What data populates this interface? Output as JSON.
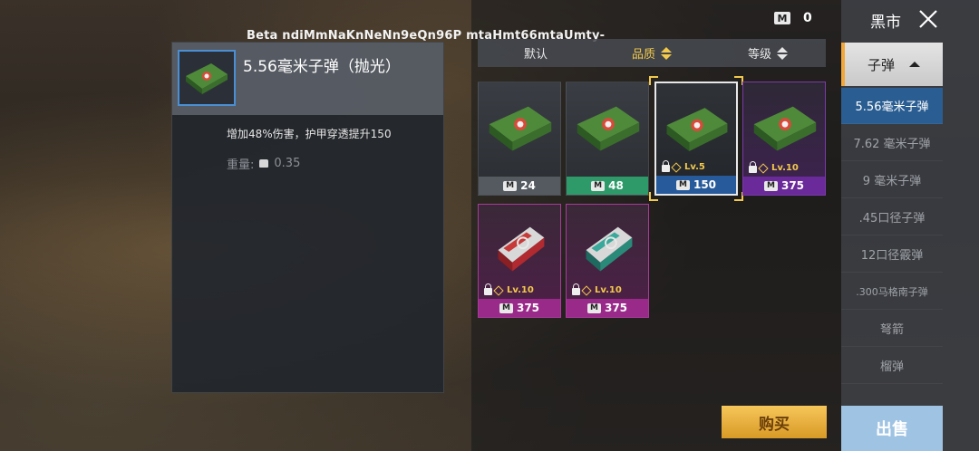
{
  "watermark": "Beta ndiMmNaKnNeNn9eQn96P mtaHmt66mtaUmty-",
  "currency": {
    "icon": "m-coin-icon",
    "badge": "M",
    "value": "0"
  },
  "detail": {
    "title": "5.56毫米子弹（抛光）",
    "description": "增加48%伤害，护甲穿透提升150",
    "weight_label": "重量:",
    "weight_value": "0.35"
  },
  "sort": {
    "default": "默认",
    "quality": "品质",
    "level": "等级"
  },
  "items": [
    {
      "price": "24",
      "color": "#555a60",
      "lock": "",
      "art": "green-box"
    },
    {
      "price": "48",
      "color": "#2e9a6a",
      "lock": "",
      "art": "green-box"
    },
    {
      "price": "150",
      "color": "#275a9b",
      "lock": "Lv.5",
      "art": "green-box",
      "selected": true
    },
    {
      "price": "375",
      "color": "#6a2a9a",
      "lock": "Lv.10",
      "art": "green-box"
    },
    {
      "price": "375",
      "color": "#9a2a8a",
      "lock": "Lv.10",
      "art": "red-box"
    },
    {
      "price": "375",
      "color": "#9a2a8a",
      "lock": "Lv.10",
      "art": "teal-box"
    }
  ],
  "sidebar": {
    "title": "黑市",
    "category": "子弹",
    "sub_items": [
      {
        "label": "5.56毫米子弹",
        "active": true
      },
      {
        "label": "7.62 毫米子弹"
      },
      {
        "label": "9 毫米子弹"
      },
      {
        "label": ".45口径子弹"
      },
      {
        "label": "12口径霰弹"
      },
      {
        "label": ".300马格南子弹"
      },
      {
        "label": "弩箭"
      },
      {
        "label": "榴弹"
      }
    ],
    "sell": "出售"
  },
  "buy": "购买",
  "colors": {
    "accent": "#f2c94c",
    "sell": "#9fc3e3",
    "selected_blue": "#275a9b"
  }
}
